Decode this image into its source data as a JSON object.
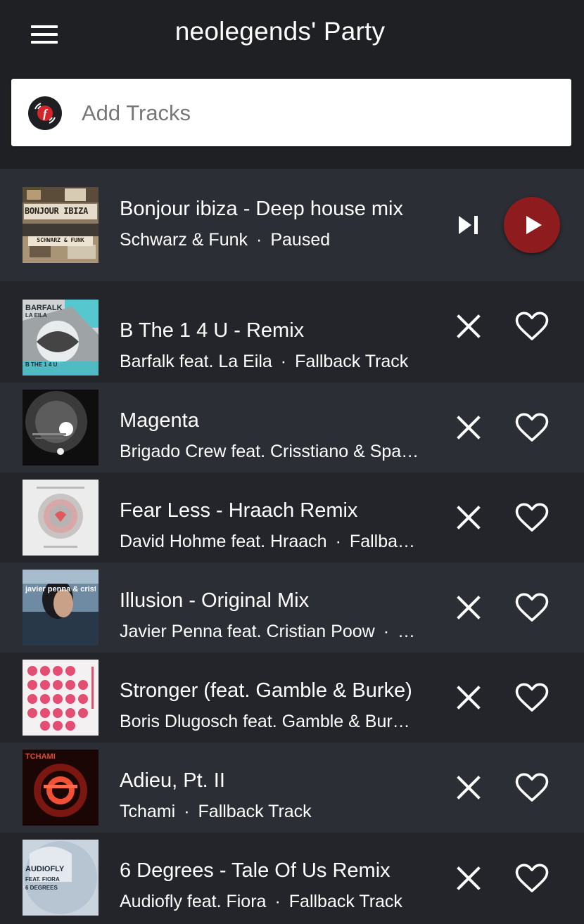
{
  "app": {
    "title": "neolegends' Party"
  },
  "search": {
    "placeholder": "Add Tracks"
  },
  "now_playing": {
    "title": "Bonjour ibiza - Deep house mix",
    "artist": "Schwarz & Funk",
    "status": "Paused",
    "cover_text_top": "BONJOUR IBIZA",
    "cover_text_bottom": "SCHWARZ & FUNK"
  },
  "queue": [
    {
      "title": "B The 1 4 U - Remix",
      "artist": "Barfalk feat. La Eila",
      "status": "Fallback Track",
      "cover_text_top": "BARFALK",
      "cover_text_sub": "LA EILA",
      "cover_text_bottom": "B THE 1 4 U"
    },
    {
      "title": "Magenta",
      "artist": "Brigado Crew feat. Crisstiano & Spa…",
      "status": ""
    },
    {
      "title": "Fear Less - Hraach Remix",
      "artist": "David Hohme feat. Hraach",
      "status": "Fallba…"
    },
    {
      "title": "Illusion - Original Mix",
      "artist": "Javier Penna feat. Cristian Poow",
      "status": "…",
      "cover_text": "javier penna & cristian poow"
    },
    {
      "title": "Stronger (feat. Gamble & Burke)",
      "artist": "Boris Dlugosch feat. Gamble & Bur…",
      "status": ""
    },
    {
      "title": "Adieu, Pt. II",
      "artist": "Tchami",
      "status": "Fallback Track",
      "cover_text": "TCHAMI"
    },
    {
      "title": "6 Degrees - Tale Of Us Remix",
      "artist": "Audiofly feat. Fiora",
      "status": "Fallback Track",
      "cover_text_top": "AUDIOFLY",
      "cover_text_sub": "FEAT. FIORA",
      "cover_text_bottom": "6 DEGREES"
    }
  ],
  "icons": {
    "menu": "menu-icon",
    "logo": "festify-logo-icon",
    "skip": "skip-next-icon",
    "play": "play-icon",
    "remove": "close-icon",
    "like": "heart-outline-icon"
  },
  "colors": {
    "background": "#23252a",
    "row_alt": "#2b2e34",
    "appbar": "#1f2023",
    "accent": "#8e1c1f"
  }
}
